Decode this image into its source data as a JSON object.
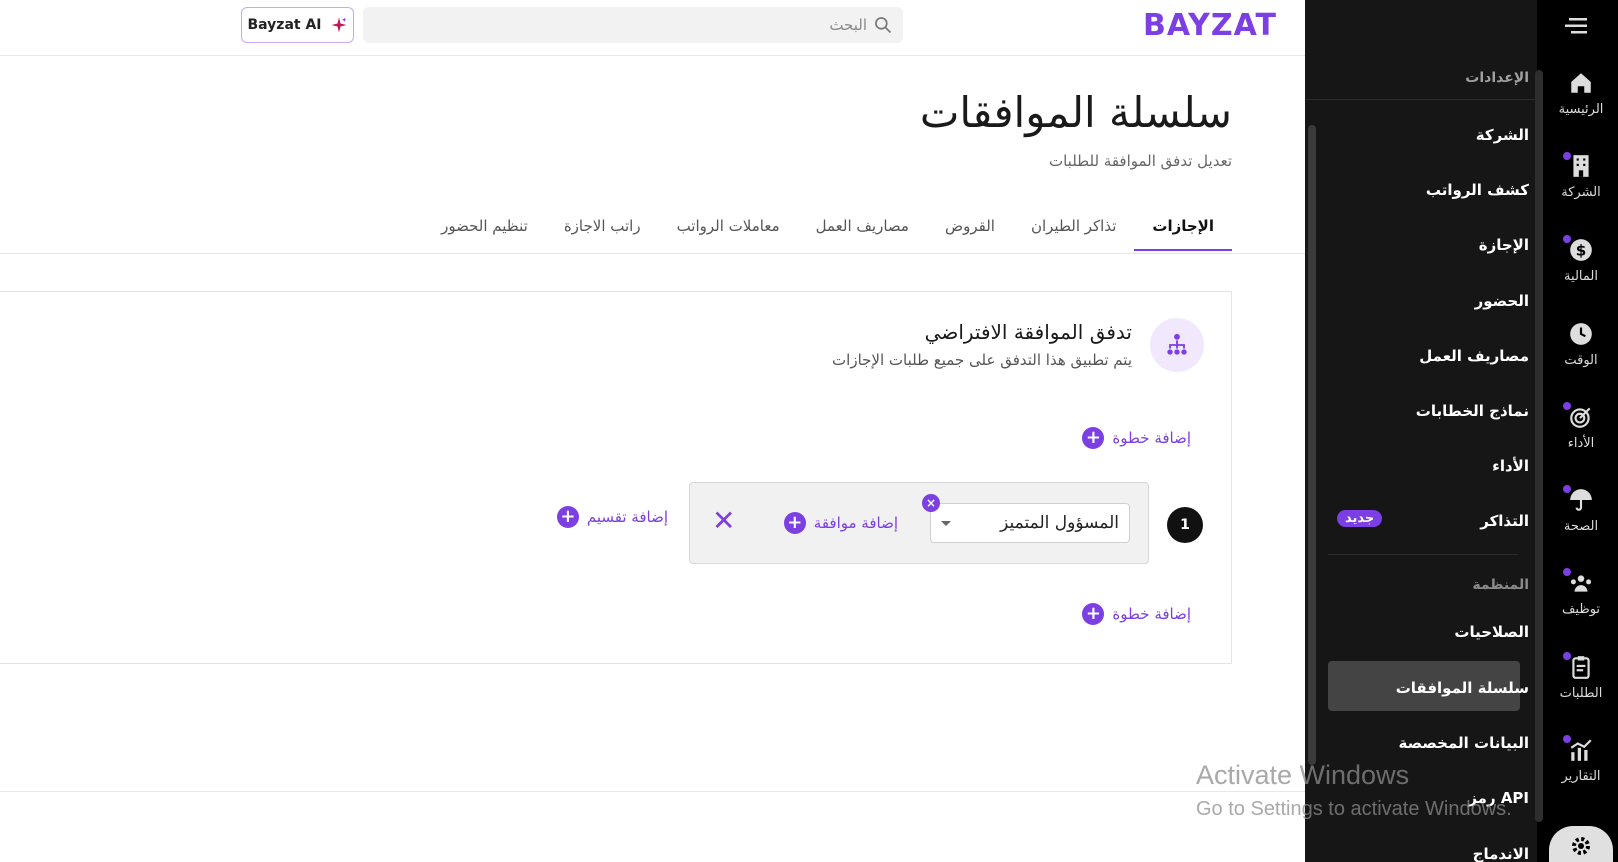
{
  "header": {
    "logo": "BAYZAT",
    "search_placeholder": "البحث",
    "ai_button": "Bayzat AI"
  },
  "page": {
    "title": "سلسلة الموافقات",
    "subtitle": "تعديل تدفق الموافقة للطلبات"
  },
  "tabs": [
    {
      "label": "الإجازات",
      "active": true
    },
    {
      "label": "تذاكر الطيران"
    },
    {
      "label": "القروض"
    },
    {
      "label": "مصاريف العمل"
    },
    {
      "label": "معاملات الرواتب"
    },
    {
      "label": "راتب الاجازة"
    },
    {
      "label": "تنظيم الحضور"
    }
  ],
  "flow": {
    "title": "تدفق الموافقة الافتراضي",
    "description": "يتم تطبيق هذا التدفق على جميع طلبات الإجازات",
    "add_step": "إضافة خطوة",
    "step_number": "1",
    "approver": "المسؤول المتميز",
    "add_approval": "إضافة موافقة",
    "add_split": "إضافة تقسيم",
    "remove_symbol": "×",
    "close_symbol": "✕"
  },
  "settings_panel": {
    "header": "الإعدادات",
    "items": [
      "الشركة",
      "كشف الرواتب",
      "الإجازة",
      "الحضور",
      "مصاريف العمل",
      "نماذج الخطابات",
      "الأداء",
      "التذاكر"
    ],
    "new_badge": "جديد",
    "org_section": "المنظمة",
    "org_items": [
      "الصلاحيات",
      "سلسلة الموافقات",
      "البيانات المخصصة",
      "رمز API",
      "الاندماج"
    ]
  },
  "rail": {
    "items": [
      "الرئيسية",
      "الشركة",
      "المالية",
      "الوقت",
      "الأداء",
      "الصحة",
      "توظيف",
      "الطلبات",
      "التقارير"
    ]
  },
  "watermark": {
    "line1": "Activate Windows",
    "line2": "Go to Settings to activate Windows."
  },
  "colors": {
    "accent": "#7b3fe4",
    "panel_bg": "#161616",
    "rail_bg": "#000000"
  }
}
